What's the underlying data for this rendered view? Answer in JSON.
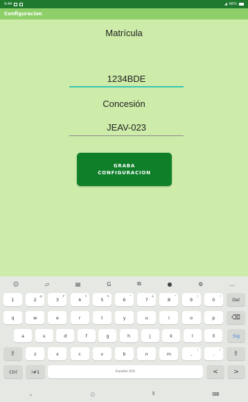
{
  "status_bar": {
    "time": "9:44",
    "battery": "66%"
  },
  "app_bar": {
    "title": "Configuracion"
  },
  "form": {
    "matricula_label": "Matrícula",
    "matricula_value": "1234BDE",
    "concesion_label": "Concesión",
    "concesion_value": "JEAV-023",
    "save_button_line1": "GRABA",
    "save_button_line2": "CONFIGURACION"
  },
  "colors": {
    "status_bar": "#1f7a2e",
    "app_bar": "#8fcf6a",
    "content_bg": "#cdeba9",
    "button_bg": "#0f7f2a",
    "active_underline": "#37c7b3"
  },
  "keyboard": {
    "suggestions": [
      {
        "icon": "emoji-icon",
        "glyph": "☺"
      },
      {
        "icon": "sticker-icon",
        "glyph": "▱"
      },
      {
        "icon": "clipboard-icon",
        "glyph": "▤"
      },
      {
        "icon": "gif-icon",
        "glyph": "G"
      },
      {
        "icon": "translate-icon",
        "glyph": "⧉"
      },
      {
        "icon": "mic-icon",
        "glyph": "●"
      },
      {
        "icon": "settings-icon",
        "glyph": "⚙"
      },
      {
        "icon": "more-icon",
        "glyph": "…"
      }
    ],
    "row1": [
      {
        "label": "1",
        "sup": ""
      },
      {
        "label": "2",
        "sup": "@"
      },
      {
        "label": "3",
        "sup": "#"
      },
      {
        "label": "4",
        "sup": "€"
      },
      {
        "label": "5",
        "sup": "%"
      },
      {
        "label": "6",
        "sup": "^"
      },
      {
        "label": "7",
        "sup": "&"
      },
      {
        "label": "8",
        "sup": "*"
      },
      {
        "label": "9",
        "sup": "("
      },
      {
        "label": "0",
        "sup": ")"
      },
      {
        "label": "Del",
        "sup": ""
      }
    ],
    "row2": [
      "q",
      "w",
      "e",
      "r",
      "t",
      "y",
      "u",
      "i",
      "o",
      "p",
      "⌫"
    ],
    "row3": [
      "a",
      "s",
      "d",
      "f",
      "g",
      "h",
      "j",
      "k",
      "l",
      "ñ",
      "Sig"
    ],
    "row4": [
      "⇧",
      "z",
      "x",
      "c",
      "v",
      "b",
      "n",
      "m",
      ",",
      ".",
      "⇧"
    ],
    "row4_sup": {
      "comma": "!",
      "period": "?"
    },
    "row5": {
      "ctrl": "Ctrl",
      "symbols": "!#1",
      "space": "Español (ES)",
      "left": "<",
      "right": ">"
    },
    "nav": [
      {
        "icon": "hide-keyboard-icon",
        "glyph": "⌄"
      },
      {
        "icon": "home-icon",
        "glyph": "○"
      },
      {
        "icon": "recents-icon",
        "glyph": "⦀"
      },
      {
        "icon": "keyboard-switch-icon",
        "glyph": "⌨"
      }
    ]
  }
}
